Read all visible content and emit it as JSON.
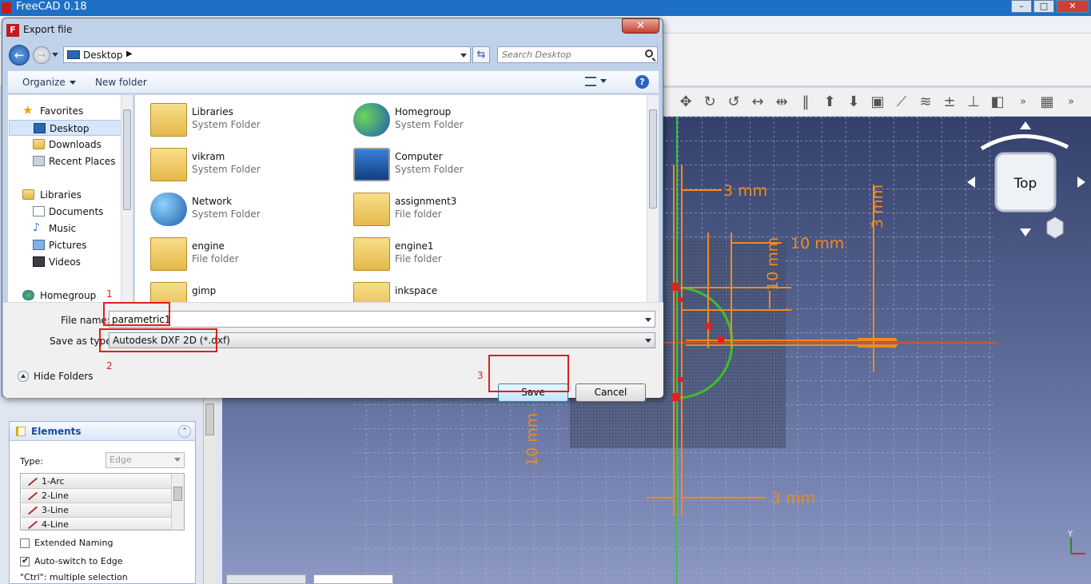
{
  "app": {
    "title": "FreeCAD 0.18"
  },
  "dialog": {
    "title": "Export file",
    "address": {
      "location": "Desktop"
    },
    "search": {
      "placeholder": "Search Desktop"
    },
    "toolbar": {
      "organize": "Organize",
      "new_folder": "New folder"
    },
    "nav": {
      "favorites": "Favorites",
      "favorite_items": [
        "Desktop",
        "Downloads",
        "Recent Places"
      ],
      "libraries": "Libraries",
      "library_items": [
        "Documents",
        "Music",
        "Pictures",
        "Videos"
      ],
      "homegroup": "Homegroup"
    },
    "files": [
      {
        "name": "Libraries",
        "kind": "System Folder"
      },
      {
        "name": "Homegroup",
        "kind": "System Folder"
      },
      {
        "name": "vikram",
        "kind": "System Folder"
      },
      {
        "name": "Computer",
        "kind": "System Folder"
      },
      {
        "name": "Network",
        "kind": "System Folder"
      },
      {
        "name": "assignment3",
        "kind": "File folder"
      },
      {
        "name": "engine",
        "kind": "File folder"
      },
      {
        "name": "engine1",
        "kind": "File folder"
      },
      {
        "name": "gimp",
        "kind": ""
      },
      {
        "name": "inkspace",
        "kind": ""
      }
    ],
    "file_name_label": "File name:",
    "file_name_value": "parametric1",
    "save_type_label": "Save as type:",
    "save_type_value": "Autodesk DXF 2D (*.dxf)",
    "hide_folders": "Hide Folders",
    "save": "Save",
    "cancel": "Cancel",
    "annotations": [
      "1",
      "2",
      "3"
    ]
  },
  "elements_panel": {
    "title": "Elements",
    "type_label": "Type:",
    "type_value": "Edge",
    "items": [
      "1-Arc",
      "2-Line",
      "3-Line",
      "4-Line"
    ],
    "extended_naming": "Extended Naming",
    "auto_switch": "Auto-switch to Edge",
    "hint": "\"Ctrl\": multiple selection"
  },
  "view": {
    "navcube_face": "Top",
    "dimensions": [
      "3 mm",
      "10 mm",
      "10 mm",
      "3 mm",
      "10 mm",
      "3 mm"
    ],
    "axis_y": "Y"
  }
}
